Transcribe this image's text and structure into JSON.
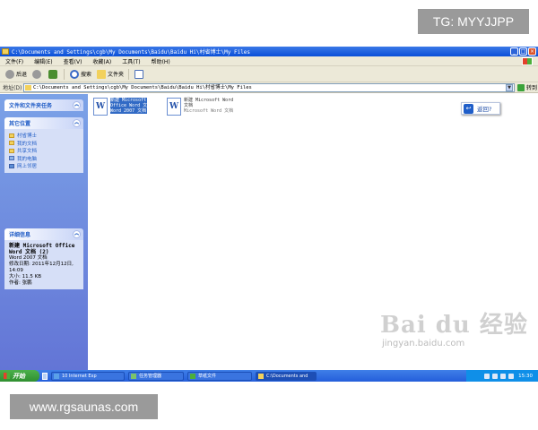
{
  "watermarks": {
    "top": "TG: MYYJJPP",
    "bottom": "www.rgsaunas.com"
  },
  "window": {
    "title": "C:\\Documents and Settings\\cgb\\My Documents\\Baidu\\Baidu Hi\\村省博士\\My Files",
    "controls": [
      "_",
      "□",
      "×"
    ]
  },
  "menu": {
    "items": [
      "文件(F)",
      "编辑(E)",
      "查看(V)",
      "收藏(A)",
      "工具(T)",
      "帮助(H)"
    ]
  },
  "toolbar": {
    "back_label": "后退",
    "search_label": "搜索",
    "folders_label": "文件夹"
  },
  "address": {
    "label": "地址(D)",
    "path": "C:\\Documents and Settings\\cgb\\My Documents\\Baidu\\Baidu Hi\\村省博士\\My Files",
    "go_label": "转到"
  },
  "sidebar": {
    "tasks_title": "文件和文件夹任务",
    "places_title": "其它位置",
    "places": [
      "村省博士",
      "我的文档",
      "共享文档",
      "我的电脑",
      "网上邻居"
    ],
    "details_title": "详细信息",
    "details": {
      "name": "新建 Microsoft Office Word 文档 (2)",
      "type": "Word 2007 文档",
      "modified": "修改日期: 2011年12月12日, 14:09",
      "size": "大小: 11.5 KB",
      "author": "作者: 张鹏"
    }
  },
  "files": [
    {
      "line1": "新建 Microsoft",
      "line2": "Office Word 文",
      "line3": "Word 2007 文档"
    },
    {
      "line1": "新建 Microsoft Word",
      "line2": "文档",
      "line3": "Microsoft Word 文档"
    }
  ],
  "back_button": {
    "label": "返回?"
  },
  "baidu": {
    "logo": "Bai du 经验",
    "sub": "jingyan.baidu.com"
  },
  "taskbar": {
    "start_label": "开始",
    "tasks": [
      "10 Internet Exp",
      "任务管理器",
      "草纸文件",
      "C:\\Documents and"
    ],
    "clock": "15:30"
  }
}
